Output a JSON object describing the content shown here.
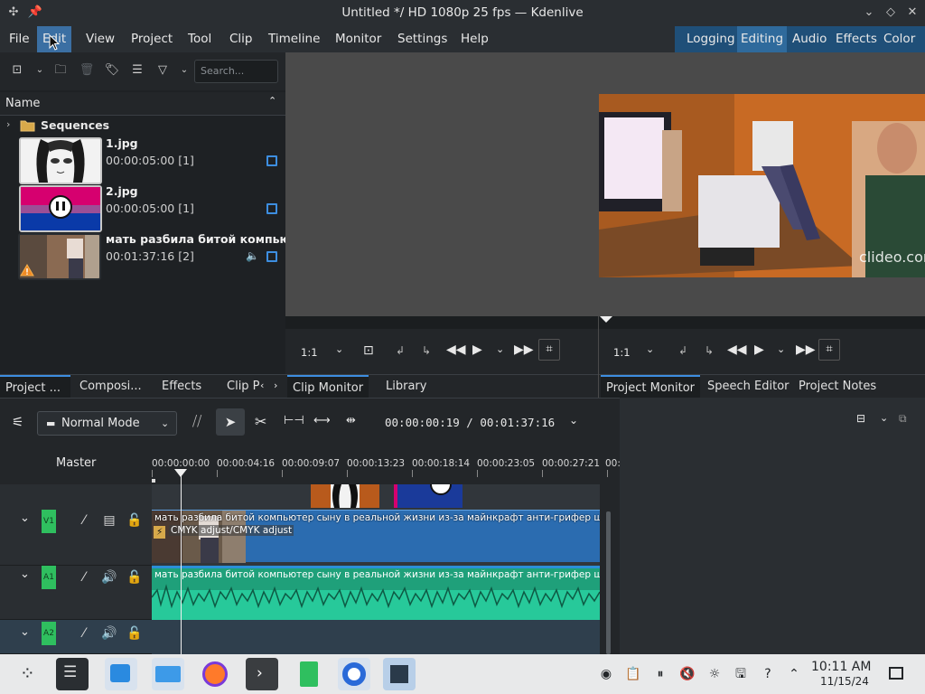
{
  "window": {
    "title": "Untitled */ HD 1080p 25 fps — Kdenlive"
  },
  "menu": [
    "File",
    "Edit",
    "View",
    "Project",
    "Tool",
    "Clip",
    "Timeline",
    "Monitor",
    "Settings",
    "Help"
  ],
  "layouts": [
    "Logging",
    "Editing",
    "Audio",
    "Effects",
    "Color"
  ],
  "bin": {
    "search_placeholder": "Search...",
    "header": "Name",
    "folder": "Sequences",
    "clips": [
      {
        "name": "1.jpg",
        "info": "00:00:05:00 [1]"
      },
      {
        "name": "2.jpg",
        "info": "00:00:05:00 [1]"
      },
      {
        "name": "мать разбила битой компьютер сыну в реальной жизни из-за майнкрафт анти-грифер шоу",
        "info": "00:01:37:16 [2]"
      }
    ],
    "tabs": [
      "Project ...",
      "Composi...",
      "Effects",
      "Clip P"
    ]
  },
  "clip_monitor": {
    "zoom": "1:1",
    "tabs": [
      "Clip Monitor",
      "Library"
    ]
  },
  "project_monitor": {
    "zoom": "1:1",
    "watermark": "clideo.com",
    "tabs": [
      "Project Monitor",
      "Speech Editor",
      "Project Notes"
    ]
  },
  "timeline": {
    "mode": "Normal Mode",
    "timecode": "00:00:00:19 / 00:01:37:16",
    "master_label": "Master",
    "ruler_labels": [
      "00:00:00:00",
      "00:00:04:16",
      "00:00:09:07",
      "00:00:13:23",
      "00:00:18:14",
      "00:00:23:05",
      "00:00:27:21",
      "00:0"
    ],
    "tracks": [
      {
        "tag": "V1",
        "clip_title": "мать разбила битой компьютер сыну в реальной жизни из-за майнкрафт анти-грифер шоу + прикол",
        "effect": "CMYK adjust/CMYK adjust"
      },
      {
        "tag": "A1",
        "clip_title": "мать разбила битой компьютер сыну в реальной жизни из-за майнкрафт анти-грифер шоу + прикол"
      },
      {
        "tag": "A2"
      }
    ]
  },
  "taskbar": {
    "time": "10:11 AM",
    "date": "11/15/24"
  }
}
